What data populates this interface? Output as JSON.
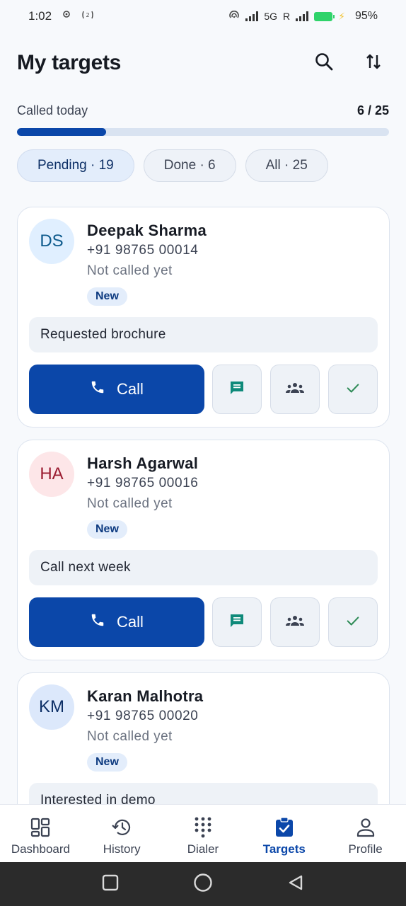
{
  "status_bar": {
    "time": "1:02",
    "network": "5G",
    "roaming": "R",
    "battery": "95%"
  },
  "header": {
    "title": "My targets",
    "search_icon": "search-icon",
    "sort_icon": "sort-icon"
  },
  "progress": {
    "label": "Called today",
    "value_text": "6 / 25",
    "called": 6,
    "total": 25
  },
  "filters": [
    {
      "label": "Pending · 19",
      "active": true
    },
    {
      "label": "Done · 6",
      "active": false
    },
    {
      "label": "All · 25",
      "active": false
    }
  ],
  "targets": [
    {
      "initials": "DS",
      "name": "Deepak Sharma",
      "phone": "+91 98765 00014",
      "status": "Not called yet",
      "badge": "New",
      "note": "Requested brochure",
      "call_label": "Call",
      "avatar_bg": "#e0efff",
      "avatar_fg": "#0d5a8c"
    },
    {
      "initials": "HA",
      "name": "Harsh Agarwal",
      "phone": "+91 98765 00016",
      "status": "Not called yet",
      "badge": "New",
      "note": "Call next week",
      "call_label": "Call",
      "avatar_bg": "#fde6e8",
      "avatar_fg": "#9b1c31"
    },
    {
      "initials": "KM",
      "name": "Karan Malhotra",
      "phone": "+91 98765 00020",
      "status": "Not called yet",
      "badge": "New",
      "note": "Interested in demo",
      "call_label": "Call",
      "avatar_bg": "#dce8fb",
      "avatar_fg": "#0d2f66"
    }
  ],
  "bottom_nav": [
    {
      "label": "Dashboard",
      "icon": "dashboard-icon",
      "active": false
    },
    {
      "label": "History",
      "icon": "history-icon",
      "active": false
    },
    {
      "label": "Dialer",
      "icon": "dialpad-icon",
      "active": false
    },
    {
      "label": "Targets",
      "icon": "targets-icon",
      "active": true
    },
    {
      "label": "Profile",
      "icon": "profile-icon",
      "active": false
    }
  ],
  "colors": {
    "primary": "#0b47a9",
    "message_icon": "#0f8a7a",
    "done_icon": "#2e8b57"
  }
}
